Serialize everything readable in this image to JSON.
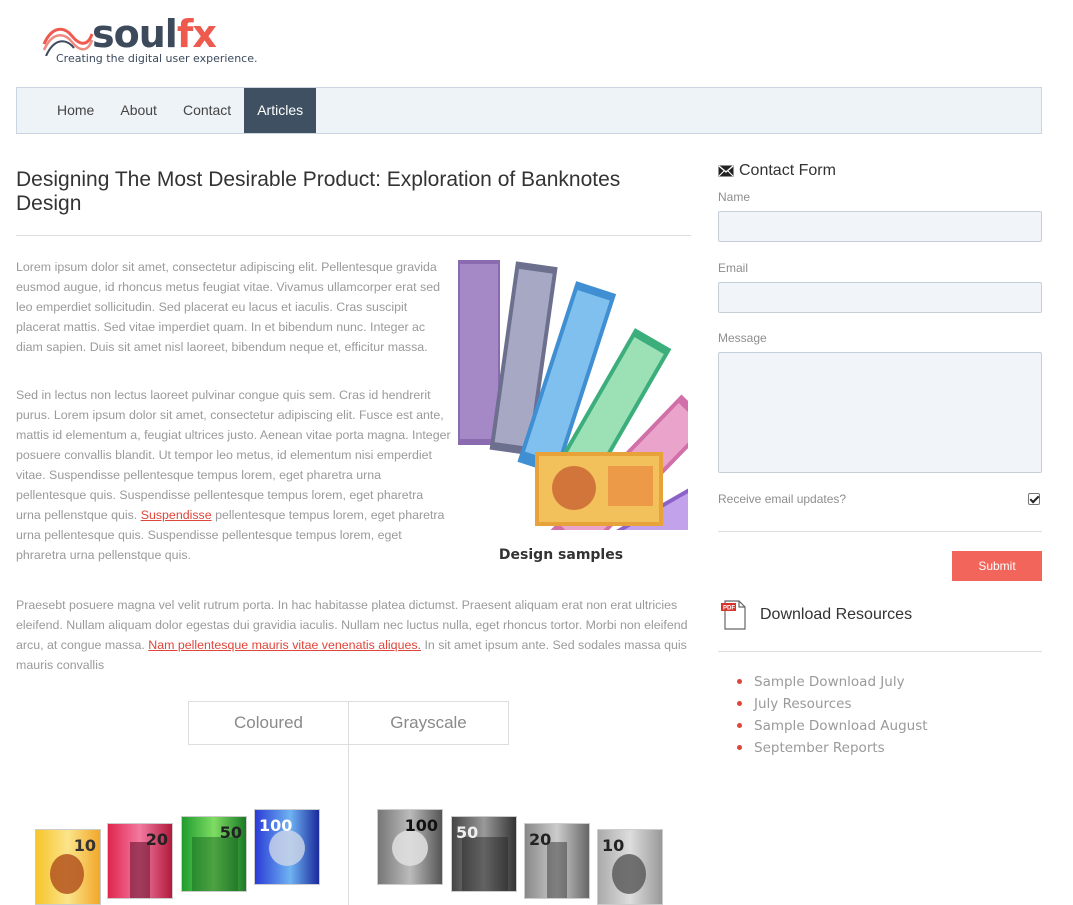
{
  "brand": {
    "name_part1": "soul",
    "name_part2": "fx",
    "tagline": "Creating the digital user experience."
  },
  "nav": {
    "items": [
      {
        "label": "Home",
        "active": false
      },
      {
        "label": "About",
        "active": false
      },
      {
        "label": "Contact",
        "active": false
      },
      {
        "label": "Articles",
        "active": true
      }
    ]
  },
  "article": {
    "title": "Designing The Most Desirable Product: Exploration of Banknotes Design",
    "p1": "Lorem ipsum dolor sit amet, consectetur adipiscing elit. Pellentesque gravida eusmod augue, id rhoncus metus feugiat vitae. Vivamus ullamcorper erat sed leo emperdiet sollicitudin. Sed placerat eu lacus et iaculis. Cras suscipit placerat mattis. Sed vitae imperdiet quam. In et bibendum nunc. Integer ac diam sapien. Duis sit amet nisl laoreet, bibendum neque et, efficitur massa.",
    "p2_before": "Sed in lectus non lectus laoreet pulvinar congue quis sem. Cras id hendrerit purus. Lorem ipsum dolor sit amet, consectetur adipiscing elit. Fusce est ante, mattis id elementum a, feugiat ultrices justo. Aenean vitae porta magna. Integer posuere convallis blandit. Ut tempor leo metus, id elementum nisi emperdiet vitae. Suspendisse pellentesque tempus lorem, eget pharetra urna pellentesque quis. Suspendisse pellentesque tempus lorem, eget pharetra urna pellenstque quis. ",
    "p2_link": "Suspendisse",
    "p2_after": " pellentesque tempus lorem, eget pharetra urna pellentesque quis. Suspendisse pellentesque tempus lorem, eget phraretra urna pellenstque quis.",
    "p3_before": "Praesebt posuere magna vel velit rutrum porta. In hac habitasse platea dictumst. Praesent aliquam erat non erat ultricies eleifend. Nullam aliquam dolor egestas dui gravidia iaculis. Nullam nec luctus nulla, eget rhoncus tortor. Morbi non eleifend arcu, at congue massa. ",
    "p3_link": "Nam pellentesque mauris vitae venenatis aliques.",
    "p3_after": " In sit amet ipsum ante. Sed sodales massa quis mauris convallis",
    "figure_caption": "Design samples",
    "compare": {
      "left": "Coloured",
      "right": "Grayscale",
      "colour_notes": [
        "10",
        "20",
        "50",
        "100"
      ],
      "gray_notes": [
        "100",
        "50",
        "20",
        "10"
      ]
    }
  },
  "contact_form": {
    "title": "Contact Form",
    "name_label": "Name",
    "email_label": "Email",
    "message_label": "Message",
    "updates_label": "Receive email updates?",
    "updates_checked": true,
    "submit_label": "Submit"
  },
  "downloads": {
    "title": "Download Resources",
    "icon_text": "PDF",
    "items": [
      "Sample Download July",
      "July Resources",
      "Sample Download August",
      "September Reports"
    ]
  },
  "colors": {
    "accent": "#f2655a",
    "nav_active": "#3f5062",
    "link": "#e0453a"
  }
}
